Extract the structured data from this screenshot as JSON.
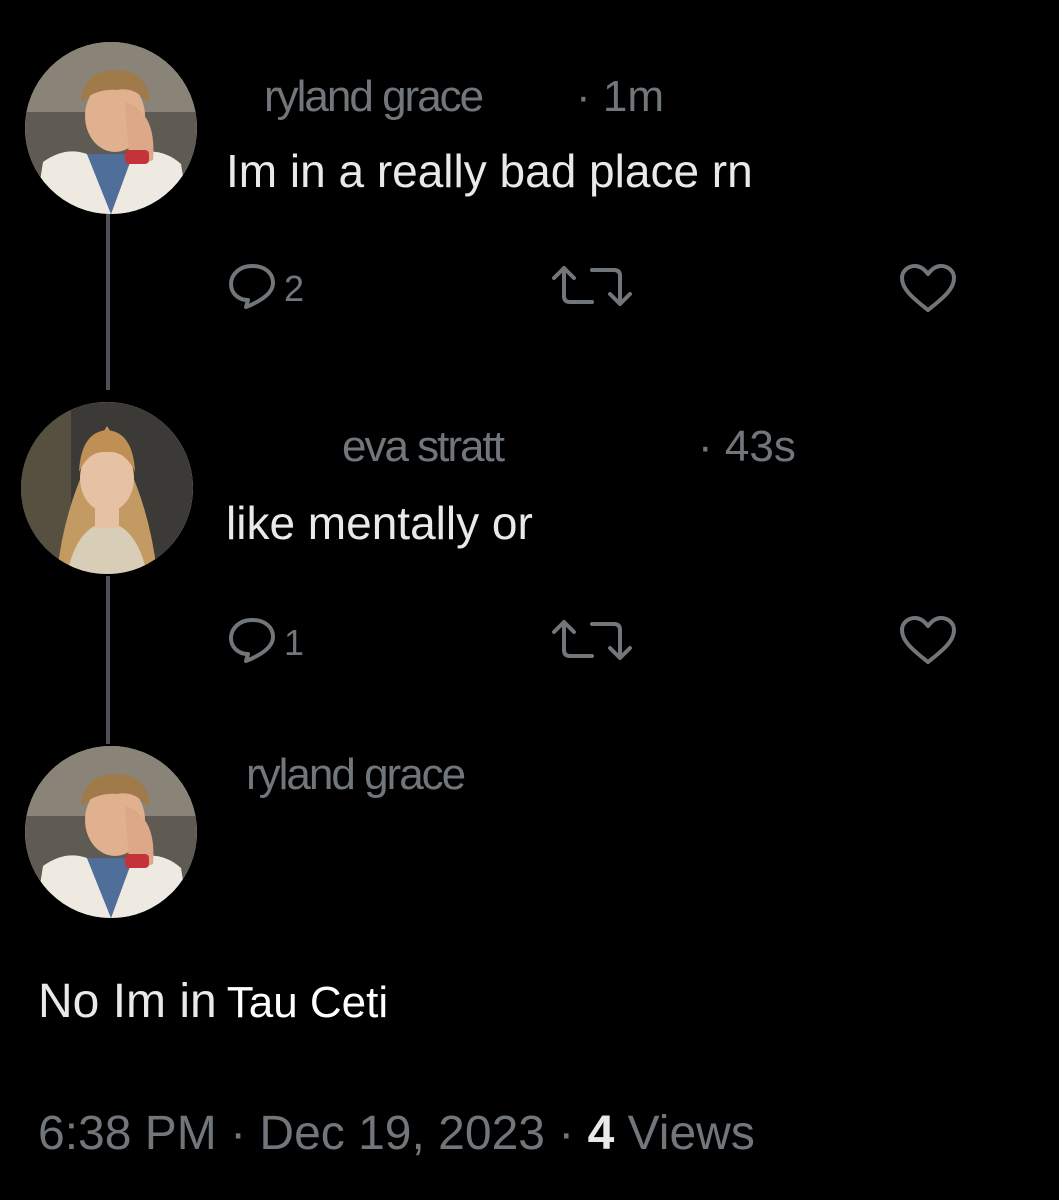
{
  "posts": [
    {
      "author": "ryland grace",
      "time": "· 1m",
      "text": "Im in a really bad place rn",
      "reply_count": "2"
    },
    {
      "author": "eva stratt",
      "time": "· 43s",
      "text": "like mentally or",
      "reply_count": "1"
    },
    {
      "author": "ryland grace",
      "text_main": "No Im in",
      "text_pasted": "Tau Ceti"
    }
  ],
  "footer": {
    "timestamp": "6:38 PM · Dec 19, 2023 · ",
    "views_count": "4",
    "views_label": " Views"
  },
  "icons": {
    "reply": "reply-bubble-icon",
    "repost": "repost-icon",
    "like": "heart-icon"
  },
  "colors": {
    "background": "#000000",
    "text_primary": "#e7e9ea",
    "text_secondary": "#71767b"
  }
}
